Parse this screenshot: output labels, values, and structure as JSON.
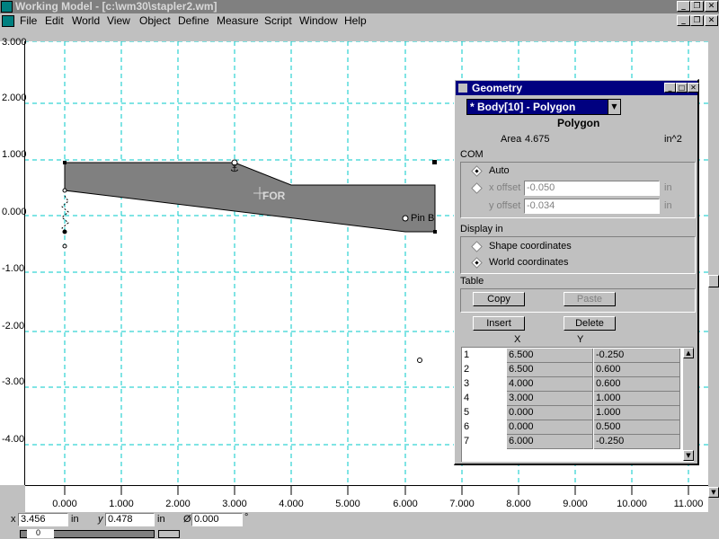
{
  "window": {
    "title": "Working Model - [c:\\wm30\\stapler2.wm]"
  },
  "menu": [
    "File",
    "Edit",
    "World",
    "View",
    "Object",
    "Define",
    "Measure",
    "Script",
    "Window",
    "Help"
  ],
  "rulers": {
    "x_labels": [
      "0.000",
      "1.000",
      "2.000",
      "3.000",
      "4.000",
      "5.000",
      "6.000",
      "7.000",
      "8.000",
      "9.000",
      "10.000",
      "11.000"
    ],
    "y_labels": [
      "3.000",
      "2.000",
      "1.000",
      "0.000",
      "-1.00",
      "-2.00",
      "-3.00",
      "-4.00"
    ]
  },
  "canvas": {
    "body_label": "FOR",
    "pin_label": "Pin B"
  },
  "status": {
    "x_label": "x",
    "x_value": "3.456",
    "x_unit": "in",
    "y_label": "y",
    "y_value": "0.478",
    "y_unit": "in",
    "angle_label": "Ø",
    "angle_value": "0.000",
    "angle_unit": "°",
    "bottom_field": "0"
  },
  "geometry": {
    "title": "Geometry",
    "selected_body": "* Body[10] - Polygon",
    "shape_type": "Polygon",
    "area_label": "Area",
    "area_value": "4.675",
    "area_unit": "in^2",
    "com_label": "COM",
    "com_auto": "Auto",
    "x_offset_label": "x offset",
    "x_offset_value": "-0.050",
    "x_offset_unit": "in",
    "y_offset_label": "y offset",
    "y_offset_value": "-0.034",
    "y_offset_unit": "in",
    "display_in_label": "Display in",
    "shape_coords": "Shape coordinates",
    "world_coords": "World coordinates",
    "table_label": "Table",
    "copy_btn": "Copy",
    "paste_btn": "Paste",
    "insert_btn": "Insert",
    "delete_btn": "Delete",
    "col_x": "X",
    "col_y": "Y",
    "rows": [
      {
        "idx": "1",
        "x": "6.500",
        "y": "-0.250"
      },
      {
        "idx": "2",
        "x": "6.500",
        "y": "0.600"
      },
      {
        "idx": "3",
        "x": "4.000",
        "y": "0.600"
      },
      {
        "idx": "4",
        "x": "3.000",
        "y": "1.000"
      },
      {
        "idx": "5",
        "x": "0.000",
        "y": "1.000"
      },
      {
        "idx": "6",
        "x": "0.000",
        "y": "0.500"
      },
      {
        "idx": "7",
        "x": "6.000",
        "y": "-0.250"
      }
    ]
  },
  "colors": {
    "title_active": "#000080",
    "title_inactive": "#808080",
    "grid": "#00c8c8",
    "polygon_fill": "#808080"
  }
}
